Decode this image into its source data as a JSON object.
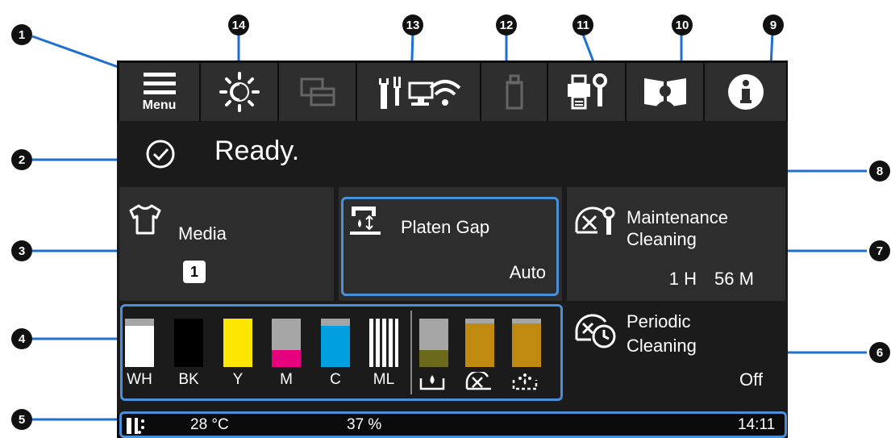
{
  "toolbar": {
    "menu_label": "Menu",
    "icons": [
      "menu-icon",
      "brightness-icon",
      "job-queue-icon",
      "network-status-icon",
      "usb-icon",
      "printer-maintenance-icon",
      "manual-icon",
      "info-icon"
    ]
  },
  "status": {
    "text": "Ready."
  },
  "media": {
    "label": "Media",
    "value": "1"
  },
  "platen_gap": {
    "label": "Platen Gap",
    "value": "Auto"
  },
  "maintenance": {
    "label_line1": "Maintenance",
    "label_line2": "Cleaning",
    "hours": "1 H",
    "minutes": "56 M"
  },
  "periodic": {
    "label_line1": "Periodic",
    "label_line2": "Cleaning",
    "value": "Off"
  },
  "inks": [
    {
      "label": "WH",
      "color": "#ffffff",
      "level": 0.85
    },
    {
      "label": "BK",
      "color": "#000000",
      "level": 1.0
    },
    {
      "label": "Y",
      "color": "#ffe600",
      "level": 1.0
    },
    {
      "label": "M",
      "color": "#e6007e",
      "level": 0.35
    },
    {
      "label": "C",
      "color": "#00a0e0",
      "level": 0.85
    },
    {
      "label": "ML",
      "color": "#ffffff",
      "level": 1.0
    },
    {
      "label": "",
      "color": "#6a6a1a",
      "level": 0.35
    },
    {
      "label": "",
      "color": "#c08a10",
      "level": 0.9
    },
    {
      "label": "",
      "color": "#c08a10",
      "level": 0.9
    }
  ],
  "bottom": {
    "temperature": "28 °C",
    "humidity": "37 %",
    "time": "14:11"
  },
  "callouts": [
    "1",
    "2",
    "3",
    "4",
    "5",
    "6",
    "7",
    "8",
    "9",
    "10",
    "11",
    "12",
    "13",
    "14"
  ],
  "accent_color": "#4a90d9"
}
